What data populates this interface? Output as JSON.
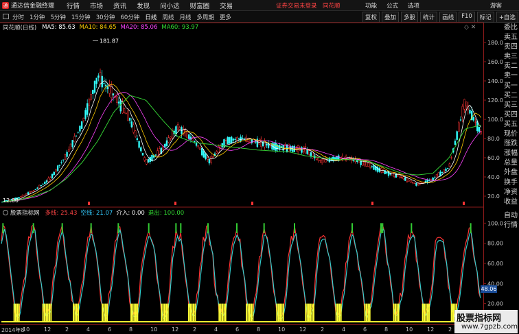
{
  "titlebar": {
    "app_title": "通达信金融终端",
    "menu": [
      "行情",
      "市场",
      "资讯",
      "发现",
      "问小达",
      "财富圈",
      "交易"
    ],
    "notice": "证券交易未登录",
    "brand": "同花顺",
    "right_menu": [
      "功能",
      "公式",
      "选项"
    ],
    "guest": "游客"
  },
  "toolbar": {
    "periods": [
      "分时",
      "1分钟",
      "5分钟",
      "15分钟",
      "30分钟",
      "60分钟",
      "日线",
      "周线",
      "月线",
      "多周期",
      "更多"
    ],
    "active_period": "日线",
    "right_tools": [
      "复权",
      "叠加",
      "多股",
      "统计",
      "画线",
      "F10",
      "标记",
      "+自选"
    ]
  },
  "price_panel": {
    "label": "同花顺(日线)",
    "ma5": "MA5: 85.63",
    "ma10": "MA10: 84.65",
    "ma20": "MA20: 85.06",
    "ma60": "MA60: 93.97",
    "high_label": "181.87",
    "low_label": "12.80",
    "y_ticks": [
      "180.0",
      "160.0",
      "140.0",
      "120.0",
      "100.0",
      "80.0",
      "60.0",
      "40.0",
      "20.0"
    ]
  },
  "side_labels": [
    "委比",
    "卖五",
    "卖四",
    "卖三",
    "卖二",
    "卖一",
    "买一",
    "买二",
    "买三",
    "买四",
    "买五",
    "现价",
    "涨跌",
    "涨幅",
    "总量",
    "外盘",
    "换手",
    "净资",
    "收益"
  ],
  "side_labels_2": [
    "自动",
    "行情"
  ],
  "indicator_panel": {
    "name": "股票指标网",
    "dx": "多线: 25.43",
    "kx": "空线: 21.07",
    "jr": "介入: 0.00",
    "tc": "退出: 100.00",
    "y_ticks": [
      "100.0",
      "80.00",
      "60.00",
      "40.00",
      "20.00"
    ],
    "current_value": "48.06"
  },
  "x_axis": {
    "labels": [
      "2014年8",
      "10",
      "12",
      "2",
      "4",
      "6",
      "8",
      "10",
      "12",
      "2",
      "4",
      "6",
      "8",
      "10",
      "12",
      "2",
      "4",
      "6",
      "8",
      "10",
      "12",
      "2",
      "4"
    ]
  },
  "watermark": {
    "line1": "股票指标网",
    "line2": "www.7gpzb.com"
  },
  "chart_data": {
    "type": "line",
    "title": "同花顺(日线)",
    "ylim": [
      10,
      190
    ],
    "series": [
      {
        "name": "MA60",
        "values": [
          14,
          16,
          20,
          26,
          38,
          55,
          78,
          108,
          125,
          120,
          100,
          82,
          76,
          74,
          72,
          70,
          68,
          67,
          66,
          62,
          60,
          58,
          58,
          56,
          50,
          44,
          42,
          44,
          60,
          90,
          94
        ]
      }
    ],
    "price_close": [
      14,
      18,
      26,
      38,
      62,
      95,
      145,
      125,
      100,
      55,
      68,
      92,
      78,
      56,
      78,
      80,
      76,
      72,
      70,
      68,
      56,
      60,
      58,
      52,
      45,
      40,
      32,
      38,
      50,
      118,
      86
    ]
  }
}
